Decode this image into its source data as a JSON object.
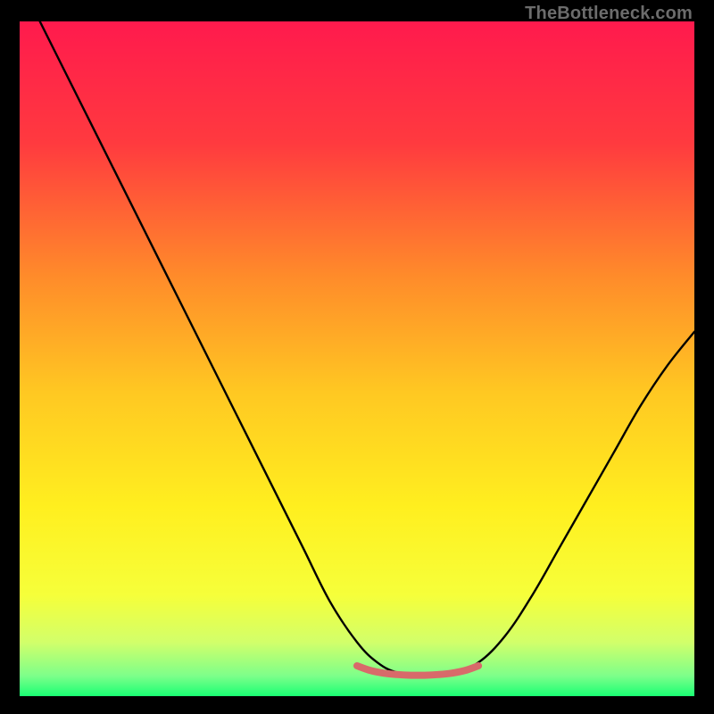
{
  "watermark": "TheBottleneck.com",
  "chart_data": {
    "type": "line",
    "title": "",
    "xlabel": "",
    "ylabel": "",
    "xlim": [
      0,
      100
    ],
    "ylim": [
      0,
      100
    ],
    "legend": false,
    "grid": false,
    "background_gradient": {
      "stops": [
        {
          "offset": 0.0,
          "color": "#ff1a4d"
        },
        {
          "offset": 0.18,
          "color": "#ff3a3f"
        },
        {
          "offset": 0.38,
          "color": "#ff8c2a"
        },
        {
          "offset": 0.55,
          "color": "#ffc822"
        },
        {
          "offset": 0.72,
          "color": "#ffef1f"
        },
        {
          "offset": 0.85,
          "color": "#f6ff3a"
        },
        {
          "offset": 0.92,
          "color": "#d2ff6a"
        },
        {
          "offset": 0.97,
          "color": "#7dff8a"
        },
        {
          "offset": 1.0,
          "color": "#1aff74"
        }
      ]
    },
    "series": [
      {
        "name": "bottleneck-curve",
        "stroke": "#000000",
        "stroke_width": 2.4,
        "x": [
          3,
          6,
          10,
          14,
          18,
          22,
          26,
          30,
          34,
          38,
          42,
          46,
          50,
          53,
          56,
          60,
          64,
          68,
          72,
          76,
          80,
          84,
          88,
          92,
          96,
          100
        ],
        "y": [
          100,
          94,
          86,
          78,
          70,
          62,
          54,
          46,
          38,
          30,
          22,
          14,
          8,
          5,
          3.5,
          3.2,
          3.5,
          5,
          9,
          15,
          22,
          29,
          36,
          43,
          49,
          54
        ]
      },
      {
        "name": "optimal-band",
        "stroke": "#d86a6a",
        "stroke_width": 8,
        "x": [
          50,
          52,
          54,
          56,
          58,
          60,
          62,
          64,
          66,
          68
        ],
        "y": [
          4.5,
          3.8,
          3.4,
          3.2,
          3.1,
          3.1,
          3.2,
          3.4,
          3.8,
          4.5
        ]
      }
    ]
  }
}
